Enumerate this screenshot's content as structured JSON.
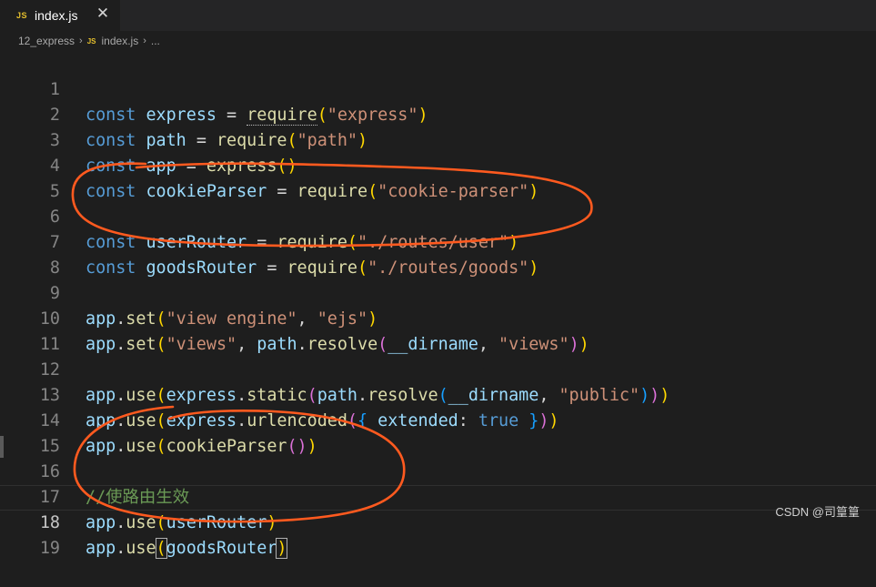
{
  "tab": {
    "icon_text": "JS",
    "filename": "index.js",
    "close_glyph": "✕"
  },
  "breadcrumb": {
    "folder": "12_express",
    "file_icon": "JS",
    "file": "index.js",
    "more": "...",
    "separator": "›"
  },
  "code_lines": [
    {
      "n": "1"
    },
    {
      "n": "2"
    },
    {
      "n": "3"
    },
    {
      "n": "4"
    },
    {
      "n": "5"
    },
    {
      "n": "6"
    },
    {
      "n": "7"
    },
    {
      "n": "8"
    },
    {
      "n": "9"
    },
    {
      "n": "10"
    },
    {
      "n": "11"
    },
    {
      "n": "12"
    },
    {
      "n": "13"
    },
    {
      "n": "14"
    },
    {
      "n": "15"
    },
    {
      "n": "16"
    },
    {
      "n": "17"
    },
    {
      "n": "18"
    },
    {
      "n": "19"
    }
  ],
  "tokens": {
    "const": "const",
    "eq": " = ",
    "require": "require",
    "express": "express",
    "path": "path",
    "app": "app",
    "cookieParser": "cookieParser",
    "userRouter": "userRouter",
    "goodsRouter": "goodsRouter",
    "set": "set",
    "use": "use",
    "static": "static",
    "resolve": "resolve",
    "urlencoded": "urlencoded",
    "dirname": "__dirname",
    "extended": "extended",
    "true": "true",
    "s_express": "\"express\"",
    "s_path": "\"path\"",
    "s_cookie": "\"cookie-parser\"",
    "s_user": "\"./routes/user\"",
    "s_goods": "\"./routes/goods\"",
    "s_view_engine": "\"view engine\"",
    "s_ejs": "\"ejs\"",
    "s_views": "\"views\"",
    "s_public": "\"public\"",
    "comment": "//使路由生效"
  },
  "watermark": "CSDN @司篁篁",
  "colors": {
    "background": "#1e1e1e",
    "keyword": "#569cd6",
    "variable": "#9cdcfe",
    "function": "#dcdcaa",
    "string": "#ce9178",
    "comment": "#6a9955",
    "annotation": "#ff5a1f"
  }
}
